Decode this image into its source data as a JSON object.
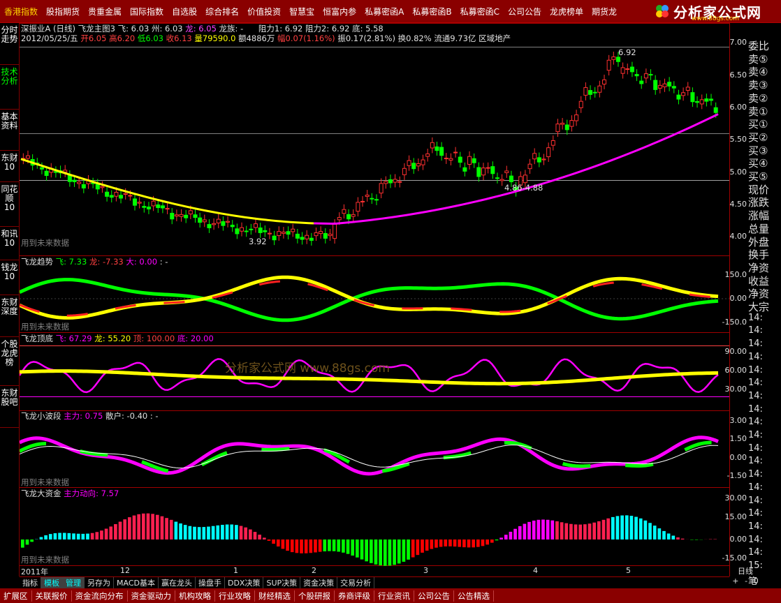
{
  "nav": {
    "items": [
      "香港指数",
      "股指期货",
      "贵重金属",
      "国际指数",
      "自选股",
      "综合排名",
      "价值投资",
      "智慧宝",
      "恒富内参",
      "私募密函A",
      "私募密函B",
      "私募密函C",
      "公司公告",
      "龙虎榜单",
      "期货龙"
    ],
    "logo_text": "分析家公式网",
    "logo_url": "www.88gs.com"
  },
  "left_tabs": [
    "分时走势",
    "技术分析",
    "基本资料",
    "东财10",
    "同花顺10",
    "和讯10",
    "钱龙10",
    "东财深度",
    "个股龙虎榜",
    "东财股吧"
  ],
  "header": {
    "main": {
      "stock": "深振业A",
      "period": "(日线)",
      "indicator": "飞龙主图3",
      "fei": "飞: 6.03",
      "zhou": "州: 6.03",
      "long": "龙: 6.05",
      "longzu": "龙族: -",
      "zuli1": "阻力1: 6.92",
      "zuli2": "阻力2: 6.92",
      "di": "底: 5.58"
    },
    "quote": {
      "date": "2012/05/25/五",
      "open": "开6.05",
      "high": "高6.20",
      "low": "低6.03",
      "close": "收6.13",
      "vol": "量79590.0",
      "amount": "额4886万",
      "pct": "幅0.07(1.16%)",
      "amp": "振0.17(2.81%)",
      "turn": "换0.82%",
      "float": "流通9.73亿",
      "sector": "区域地产"
    },
    "trend": {
      "name": "飞龙趋势",
      "fei": "飞: 7.33",
      "long": "龙: -7.33",
      "da": "大: 0.00",
      "extra": ": -"
    },
    "top_bottom": {
      "name": "飞龙顶底",
      "fei": "飞: 67.29",
      "long": "龙: 55.20",
      "ding": "顶: 100.00",
      "di": "底: 20.00"
    },
    "wave": {
      "name": "飞龙小波段",
      "main": "主力: 0.75",
      "retail": "散户: -0.40",
      "extra": ": -"
    },
    "capital": {
      "name": "飞龙大资金",
      "flow": "主力动向: 7.57"
    }
  },
  "future_data_label": "用到未来数据",
  "annotations": {
    "high": "6.92",
    "low": "3.92",
    "range": "4.86-4.88",
    "watermark": "分析家公式网 www.88gs.com"
  },
  "axis": {
    "main": [
      "7.00",
      "6.50",
      "6.00",
      "5.50",
      "5.00",
      "4.50",
      "4.00"
    ],
    "trend": [
      "150.0",
      "0.00",
      "-150.0"
    ],
    "topbottom": [
      "90.00",
      "60.00",
      "30.00"
    ],
    "wave": [
      "3.00",
      "1.50",
      "0.00",
      "-1.50"
    ],
    "capital": [
      "30.00",
      "15.00",
      "0.00",
      "-15.00"
    ]
  },
  "xaxis": [
    "2011年",
    "12",
    "1",
    "2",
    "3",
    "4",
    "5"
  ],
  "period_label": "日线",
  "zoom": {
    "plus": "+",
    "minus": "-",
    "zero": "0"
  },
  "right_panel": [
    "委比",
    "卖⑤",
    "卖④",
    "卖③",
    "卖②",
    "卖①",
    "买①",
    "买②",
    "买③",
    "买④",
    "买⑤",
    "现价",
    "涨跌",
    "涨幅",
    "总量",
    "外盘",
    "换手",
    "净资",
    "收益",
    "净资",
    "大宗",
    "14:",
    "14:",
    "14:",
    "14:",
    "14:",
    "14:",
    "14:",
    "14:",
    "14:",
    "14:",
    "14:",
    "14:",
    "14:",
    "14:",
    "14:",
    "14:",
    "14:",
    "14:",
    "14:",
    "15:",
    "笔"
  ],
  "tool_tabs": [
    "指标",
    "模板",
    "管理",
    "另存为",
    "MACD基本",
    "赢在龙头",
    "操盘手",
    "DDX决策",
    "SUP决策",
    "资金决策",
    "交易分析"
  ],
  "bottom_bar": [
    "扩展区",
    "关联报价",
    "资金流向分布",
    "资金驱动力",
    "机构攻略",
    "行业攻略",
    "财经精选",
    "个股研报",
    "券商评级",
    "行业资讯",
    "公司公告",
    "公告精选"
  ],
  "colors": {
    "nav_bg": "#8a0000",
    "up": "#ff0000",
    "down": "#00ff00",
    "long": "#ffff00",
    "pink": "#ff00ff",
    "cyan": "#00ffff"
  }
}
